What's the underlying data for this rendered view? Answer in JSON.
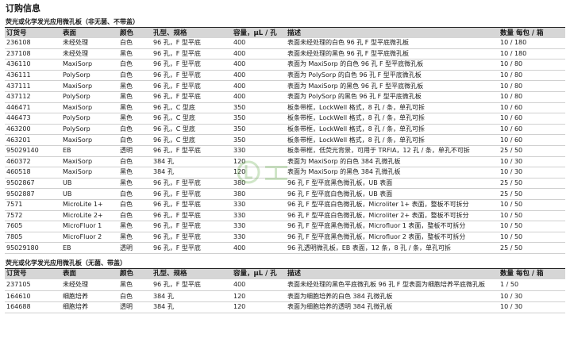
{
  "page_title": "订购信息",
  "columns": {
    "order_no": "订货号",
    "surface": "表面",
    "color": "颜色",
    "type": "孔型、规格",
    "capacity": "容量，μL / 孔",
    "description": "描述",
    "qty": "数量 每包 / 箱"
  },
  "section1": {
    "title": "荧光或化学发光应用微孔板（非无菌、不带盖）",
    "rows": [
      {
        "order_no": "236108",
        "surface": "未经处理",
        "color": "白色",
        "type": "96 孔，F 型平底",
        "capacity": "400",
        "description": "表面未经处理的白色 96 孔 F 型平底微孔板",
        "qty": "10 / 180"
      },
      {
        "order_no": "237108",
        "surface": "未经处理",
        "color": "黑色",
        "type": "96 孔，F 型平底",
        "capacity": "400",
        "description": "表面未经处理的黑色 96 孔 F 型平底微孔板",
        "qty": "10 / 180"
      },
      {
        "order_no": "436110",
        "surface": "MaxiSorp",
        "color": "白色",
        "type": "96 孔，F 型平底",
        "capacity": "400",
        "description": "表面为 MaxiSorp 的白色 96 孔 F 型平底微孔板",
        "qty": "10 / 80"
      },
      {
        "order_no": "436111",
        "surface": "PolySorp",
        "color": "白色",
        "type": "96 孔，F 型平底",
        "capacity": "400",
        "description": "表面为 PolySorp 的白色 96 孔 F 型平底微孔板",
        "qty": "10 / 80"
      },
      {
        "order_no": "437111",
        "surface": "MaxiSorp",
        "color": "黑色",
        "type": "96 孔，F 型平底",
        "capacity": "400",
        "description": "表面为 MaxiSorp 的黑色 96 孔 F 型平底微孔板",
        "qty": "10 / 80"
      },
      {
        "order_no": "437112",
        "surface": "PolySorp",
        "color": "黑色",
        "type": "96 孔，F 型平底",
        "capacity": "400",
        "description": "表面为 PolySorp 的黑色 96 孔 F 型平底微孔板",
        "qty": "10 / 80"
      },
      {
        "order_no": "446471",
        "surface": "MaxiSorp",
        "color": "黑色",
        "type": "96 孔，C 型底",
        "capacity": "350",
        "description": "板条带框，LockWell 格式，8 孔 / 条，单孔可拆",
        "qty": "10 / 60"
      },
      {
        "order_no": "446473",
        "surface": "PolySorp",
        "color": "黑色",
        "type": "96 孔，C 型底",
        "capacity": "350",
        "description": "板条带框，LockWell 格式，8 孔 / 条，单孔可拆",
        "qty": "10 / 60"
      },
      {
        "order_no": "463200",
        "surface": "PolySorp",
        "color": "白色",
        "type": "96 孔，C 型底",
        "capacity": "350",
        "description": "板条带框，LockWell 格式，8 孔 / 条，单孔可拆",
        "qty": "10 / 60"
      },
      {
        "order_no": "463201",
        "surface": "MaxiSorp",
        "color": "白色",
        "type": "96 孔，C 型底",
        "capacity": "350",
        "description": "板条带框，LockWell 格式，8 孔 / 条，单孔可拆",
        "qty": "10 / 60"
      },
      {
        "order_no": "95029140",
        "surface": "EB",
        "color": "透明",
        "type": "96 孔，F 型平底",
        "capacity": "330",
        "description": "板条带框，低荧光背景，可用于 TRFIA，12 孔 / 条，单孔不可拆",
        "qty": "25 / 50"
      },
      {
        "order_no": "460372",
        "surface": "MaxiSorp",
        "color": "白色",
        "type": "384 孔",
        "capacity": "120",
        "description": "表面为 MaxiSorp 的白色 384 孔微孔板",
        "qty": "10 / 30"
      },
      {
        "order_no": "460518",
        "surface": "MaxiSorp",
        "color": "黑色",
        "type": "384 孔",
        "capacity": "120",
        "description": "表面为 MaxiSorp 的黑色 384 孔微孔板",
        "qty": "10 / 30"
      },
      {
        "order_no": "9502867",
        "surface": "UB",
        "color": "黑色",
        "type": "96 孔，F 型平底",
        "capacity": "380",
        "description": "96 孔 F 型平底黑色微孔板，UB 表面",
        "qty": "25 / 50"
      },
      {
        "order_no": "9502887",
        "surface": "UB",
        "color": "白色",
        "type": "96 孔，F 型平底",
        "capacity": "380",
        "description": "96 孔 F 型平底白色微孔板，UB 表面",
        "qty": "25 / 50"
      },
      {
        "order_no": "7571",
        "surface": "MicroLite 1+",
        "color": "白色",
        "type": "96 孔，F 型平底",
        "capacity": "330",
        "description": "96 孔 F 型平底白色微孔板，Microliter 1+ 表面，整板不可拆分",
        "qty": "10 / 50"
      },
      {
        "order_no": "7572",
        "surface": "MicroLite 2+",
        "color": "白色",
        "type": "96 孔，F 型平底",
        "capacity": "330",
        "description": "96 孔 F 型平底白色微孔板，Microliter 2+ 表面，整板不可拆分",
        "qty": "10 / 50"
      },
      {
        "order_no": "7605",
        "surface": "MicroFluor 1",
        "color": "黑色",
        "type": "96 孔，F 型平底",
        "capacity": "330",
        "description": "96 孔 F 型平底黑色微孔板，Microfluor 1 表面，整板不可拆分",
        "qty": "10 / 50"
      },
      {
        "order_no": "7805",
        "surface": "MicroFluor 2",
        "color": "黑色",
        "type": "96 孔，F 型平底",
        "capacity": "330",
        "description": "96 孔 F 型平底黑色微孔板，Microfluor 2 表面，整板不可拆分",
        "qty": "10 / 50"
      },
      {
        "order_no": "95029180",
        "surface": "EB",
        "color": "透明",
        "type": "96 孔，F 型平底",
        "capacity": "400",
        "description": "96 孔透明微孔板，EB 表面，12 条，8 孔 / 条，单孔可拆",
        "qty": "25 / 50"
      }
    ]
  },
  "section2": {
    "title": "荧光或化学发光应用微孔板（无菌、带盖）",
    "rows": [
      {
        "order_no": "237105",
        "surface": "未经处理",
        "color": "黑色",
        "type": "96 孔，F 型平底",
        "capacity": "400",
        "description": "表面未经处理的黑色平底微孔板 96 孔 F 型表面为细胞培养平底微孔板",
        "qty": "1 / 50"
      },
      {
        "order_no": "164610",
        "surface": "细胞培养",
        "color": "白色",
        "type": "384 孔",
        "capacity": "120",
        "description": "表面为细胞培养的白色 384 孔微孔板",
        "qty": "10 / 30"
      },
      {
        "order_no": "164688",
        "surface": "细胞培养",
        "color": "透明",
        "type": "384 孔",
        "capacity": "120",
        "description": "表面为细胞培养的透明 384 孔微孔板",
        "qty": "10 / 30"
      }
    ]
  },
  "watermark": {
    "icon": "lab-logo-icon",
    "color": "#5aa83c"
  }
}
